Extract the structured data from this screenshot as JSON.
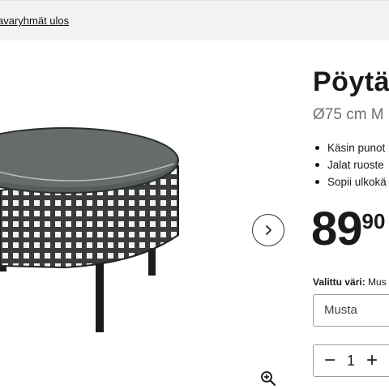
{
  "breadcrumb": {
    "link_text": "avaryhmät ulos"
  },
  "gallery": {
    "image_name": "round rattan table with glass top",
    "next_icon": "chevron-right-icon",
    "zoom_icon": "zoom-in-icon"
  },
  "product": {
    "title": "Pöytä",
    "subtitle": "Ø75 cm M",
    "features": [
      "Käsin punot",
      "Jalat ruoste",
      "Sopii ulkokä"
    ],
    "price": {
      "main": "89",
      "cents": "90"
    },
    "color_label": "Valittu väri:",
    "color_value": "Mus",
    "color_select_value": "Musta",
    "quantity": "1",
    "qty_minus": "−",
    "qty_plus": "+"
  }
}
